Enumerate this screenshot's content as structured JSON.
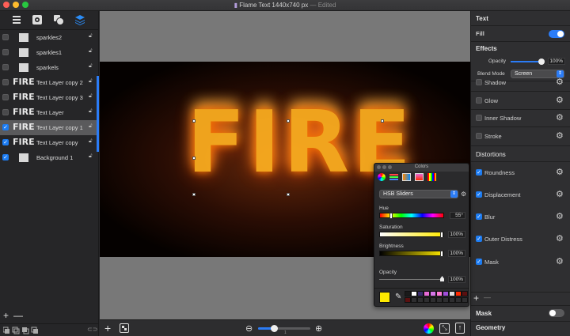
{
  "window": {
    "title": "Flame Text 1440x740 px",
    "edited": "— Edited"
  },
  "sidebar": {
    "tabs": [
      "list-icon",
      "gear-icon",
      "shapes-icon",
      "layers-icon"
    ],
    "layers": [
      {
        "name": "sparkles2",
        "checked": false,
        "fire": false
      },
      {
        "name": "sparkles1",
        "checked": false,
        "fire": false
      },
      {
        "name": "sparkels",
        "checked": false,
        "fire": false
      },
      {
        "name": "Text Layer copy 2",
        "checked": false,
        "fire": true
      },
      {
        "name": "Text Layer copy 3",
        "checked": false,
        "fire": true
      },
      {
        "name": "Text Layer",
        "checked": false,
        "fire": true
      },
      {
        "name": "Text Layer copy 1",
        "checked": true,
        "fire": true,
        "selected": true
      },
      {
        "name": "Text Layer copy",
        "checked": true,
        "fire": true
      },
      {
        "name": "Background 1",
        "checked": true,
        "fire": false
      }
    ],
    "fire_label": "FIRE",
    "add": "+",
    "remove": "—"
  },
  "canvas": {
    "text": "FIRE",
    "zoom_tick": "1"
  },
  "right": {
    "text_head": "Text",
    "fill_label": "Fill",
    "fill_on": true,
    "effects_head": "Effects",
    "opacity_label": "Opacity",
    "opacity_value": "100%",
    "blend_label": "Blend Mode",
    "blend_value": "Screen",
    "effects": [
      "Shadow",
      "Glow",
      "Inner Shadow",
      "Stroke"
    ],
    "distortions_head": "Distortions",
    "distortions": [
      "Roundness",
      "Displacement",
      "Blur",
      "Outer Distress",
      "Mask"
    ],
    "mask_label": "Mask",
    "geometry_head": "Geometry"
  },
  "colors": {
    "title": "Colors",
    "mode": "HSB Sliders",
    "hue_label": "Hue",
    "hue_value": "55°",
    "saturation_label": "Saturation",
    "saturation_value": "100%",
    "brightness_label": "Brightness",
    "brightness_value": "100%",
    "opacity_label": "Opacity",
    "opacity_value": "100%",
    "current_color": "#ffea00",
    "swatches": [
      "#1a1a1a",
      "#ffffff",
      "#3a2d6e",
      "#e86ad7",
      "#d676e8",
      "#ff7ad8",
      "#a04ed8",
      "#e0e0e0",
      "#ff2a00",
      "#5a1010"
    ]
  }
}
